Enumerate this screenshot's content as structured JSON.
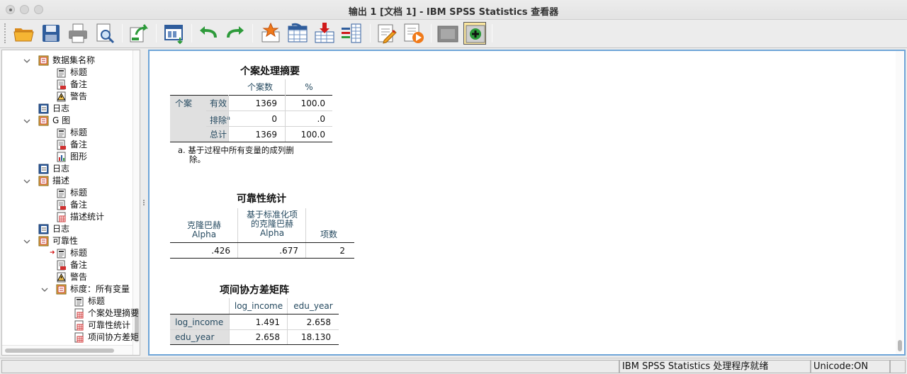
{
  "window": {
    "title": "输出 1 [文档 1] - IBM SPSS Statistics 查看器"
  },
  "toolbar": {
    "buttons": [
      {
        "icon": "open-folder-icon"
      },
      {
        "icon": "save-icon"
      },
      {
        "icon": "print-icon"
      },
      {
        "icon": "print-preview-icon"
      },
      {
        "icon": "export-icon"
      },
      {
        "icon": "recall-dialog-icon"
      },
      {
        "icon": "undo-icon"
      },
      {
        "icon": "redo-icon"
      },
      {
        "icon": "goto-data-icon"
      },
      {
        "icon": "goto-case-icon"
      },
      {
        "icon": "goto-variable-icon"
      },
      {
        "icon": "variables-icon"
      },
      {
        "icon": "edit-output-icon"
      },
      {
        "icon": "run-script-icon"
      },
      {
        "icon": "hide-icon"
      },
      {
        "icon": "insert-new-item-icon"
      }
    ]
  },
  "nav": {
    "items": [
      {
        "label": "数据集名称",
        "icon": "procedure-book-icon"
      },
      {
        "label": "标题",
        "icon": "title-doc-icon"
      },
      {
        "label": "备注",
        "icon": "notes-doc-icon"
      },
      {
        "label": "警告",
        "icon": "warning-icon"
      },
      {
        "label": "日志",
        "icon": "log-book-icon"
      },
      {
        "label": "G 图",
        "icon": "procedure-book-icon"
      },
      {
        "label": "标题",
        "icon": "title-doc-icon"
      },
      {
        "label": "备注",
        "icon": "notes-doc-icon"
      },
      {
        "label": "图形",
        "icon": "chart-doc-icon"
      },
      {
        "label": "日志",
        "icon": "log-book-icon"
      },
      {
        "label": "描述",
        "icon": "procedure-book-icon"
      },
      {
        "label": "标题",
        "icon": "title-doc-icon"
      },
      {
        "label": "备注",
        "icon": "notes-doc-icon"
      },
      {
        "label": "描述统计",
        "icon": "table-doc-icon"
      },
      {
        "label": "日志",
        "icon": "log-book-icon"
      },
      {
        "label": "可靠性",
        "icon": "procedure-book-icon"
      },
      {
        "label": "标题",
        "icon": "title-doc-icon"
      },
      {
        "label": "备注",
        "icon": "notes-doc-icon"
      },
      {
        "label": "警告",
        "icon": "warning-icon"
      },
      {
        "label": "标度：所有变量",
        "icon": "procedure-book-icon"
      },
      {
        "label": "标题",
        "icon": "title-doc-icon"
      },
      {
        "label": "个案处理摘要",
        "icon": "table-doc-icon"
      },
      {
        "label": "可靠性统计",
        "icon": "table-doc-icon"
      },
      {
        "label": "项间协方差矩阵",
        "icon": "table-doc-icon"
      }
    ]
  },
  "tables": {
    "case_summary": {
      "title": "个案处理摘要",
      "col_headers": [
        "个案数",
        "%"
      ],
      "group_label": "个案",
      "rows": [
        {
          "label": "有效",
          "sup": "",
          "n": "1369",
          "pct": "100.0"
        },
        {
          "label": "排除",
          "sup": "a",
          "n": "0",
          "pct": ".0"
        },
        {
          "label": "总计",
          "sup": "",
          "n": "1369",
          "pct": "100.0"
        }
      ],
      "footnote_line1": "a. 基于过程中所有变量的成列删",
      "footnote_line2": "除。"
    },
    "reliability": {
      "title": "可靠性统计",
      "h1_l1": "克隆巴赫",
      "h1_l2": "Alpha",
      "h2_l1": "基于标准化项",
      "h2_l2": "的克隆巴赫",
      "h2_l3": "Alpha",
      "h3": "项数",
      "v1": ".426",
      "v2": ".677",
      "v3": "2"
    },
    "covariance": {
      "title": "项间协方差矩阵",
      "col_headers": [
        "log_income",
        "edu_year"
      ],
      "rows": [
        {
          "label": "log_income",
          "v1": "1.491",
          "v2": "2.658"
        },
        {
          "label": "edu_year",
          "v1": "2.658",
          "v2": "18.130"
        }
      ]
    }
  },
  "status": {
    "processor": "IBM SPSS Statistics 处理程序就绪",
    "unicode": "Unicode:ON"
  }
}
